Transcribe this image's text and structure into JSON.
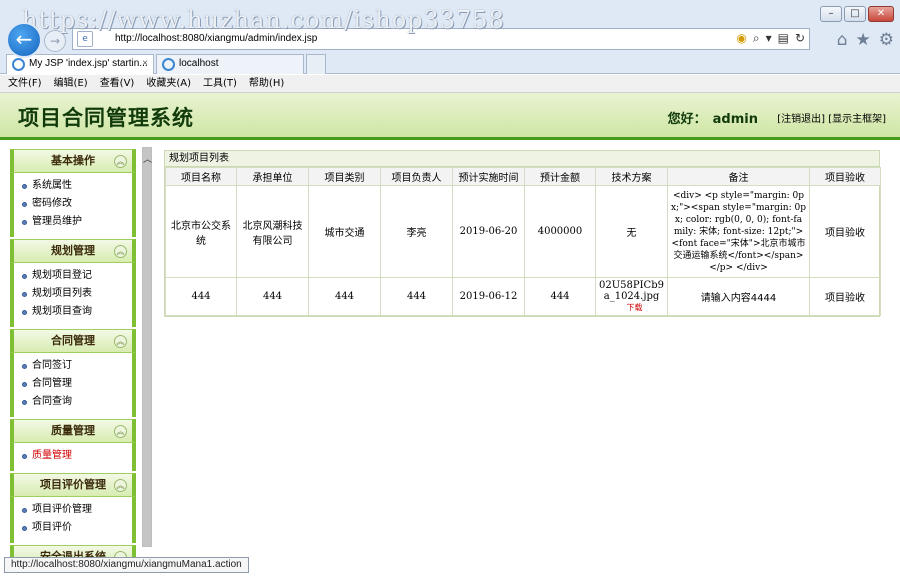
{
  "browser": {
    "watermark": "https://www.huzhan.com/ishop33758",
    "url": "http://localhost:8080/xiangmu/admin/index.jsp",
    "tabs": [
      {
        "label": "My JSP 'index.jsp' startin...",
        "close": "×"
      },
      {
        "label": "localhost"
      }
    ],
    "menu": [
      "文件(F)",
      "编辑(E)",
      "查看(V)",
      "收藏夹(A)",
      "工具(T)",
      "帮助(H)"
    ],
    "status_url": "http://localhost:8080/xiangmu/xiangmuMana1.action"
  },
  "header": {
    "title": "项目合同管理系统",
    "greeting": "您好：",
    "user": "admin",
    "logout": "[注销退出]",
    "home": "[显示主框架]"
  },
  "sidebar": {
    "sections": [
      {
        "title": "基本操作",
        "items": [
          "系统属性",
          "密码修改",
          "管理员维护"
        ]
      },
      {
        "title": "规划管理",
        "items": [
          "规划项目登记",
          "规划项目列表",
          "规划项目查询"
        ]
      },
      {
        "title": "合同管理",
        "items": [
          "合同签订",
          "合同管理",
          "合同查询"
        ]
      },
      {
        "title": "质量管理",
        "items": [
          "质量管理"
        ]
      },
      {
        "title": "项目评价管理",
        "items": [
          "项目评价管理",
          "项目评价"
        ]
      },
      {
        "title": "安全退出系统",
        "items": []
      }
    ]
  },
  "main": {
    "title": "规划项目列表",
    "columns": [
      "项目名称",
      "承担单位",
      "项目类别",
      "项目负责人",
      "预计实施时间",
      "预计金额",
      "技术方案",
      "备注",
      "项目验收"
    ],
    "rows": [
      {
        "name": "北京市公交系统",
        "unit": "北京风潮科技有限公司",
        "category": "城市交通",
        "leader": "李亮",
        "date": "2019-06-20",
        "amount": "4000000",
        "tech": "无",
        "remark": "<div> <p style=\"margin: 0px;\"><span style=\"margin: 0px; color: rgb(0, 0, 0); font-family: 宋体; font-size: 12pt;\"><font face=\"宋体\">北京市城市交通运输系统</font></span></p> </div>",
        "accept": "项目验收"
      },
      {
        "name": "444",
        "unit": "444",
        "category": "444",
        "leader": "444",
        "date": "2019-06-12",
        "amount": "444",
        "tech": "02U58PICb9a_1024.jpg",
        "download": "下载",
        "remark": "请输入内容4444",
        "accept": "项目验收"
      }
    ]
  }
}
